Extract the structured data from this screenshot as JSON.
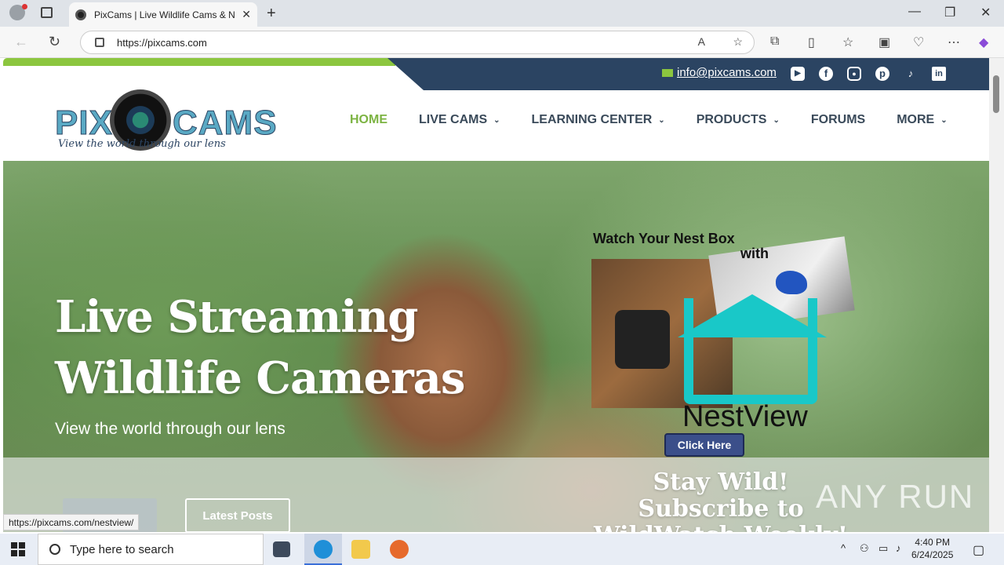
{
  "browser": {
    "tab_title": "PixCams | Live Wildlife Cams & Na",
    "url": "https://pixcams.com",
    "status_url": "https://pixcams.com/nestview/"
  },
  "site": {
    "email": "info@pixcams.com",
    "logo_left": "PIX",
    "logo_right": "CAMS",
    "logo_tagline": "View the world through our lens",
    "nav": [
      {
        "label": "HOME",
        "active": true
      },
      {
        "label": "LIVE CAMS",
        "caret": true
      },
      {
        "label": "LEARNING CENTER",
        "caret": true
      },
      {
        "label": "PRODUCTS",
        "caret": true
      },
      {
        "label": "FORUMS"
      },
      {
        "label": "MORE",
        "caret": true
      }
    ],
    "socials": [
      "youtube-icon",
      "facebook-icon",
      "instagram-icon",
      "pinterest-icon",
      "tiktok-icon",
      "linkedin-icon"
    ]
  },
  "hero": {
    "title_line1": "Live Streaming",
    "title_line2": "Wildlife Cameras",
    "subtitle": "View the world through our lens",
    "promo_head1": "Watch Your Nest Box",
    "promo_head2": "with",
    "promo_brand": "NestView",
    "promo_button": "Click Here"
  },
  "lower": {
    "btn_latest_posts": "Latest Posts",
    "subscribe_line1": "Stay Wild! Subscribe to",
    "subscribe_line2": "WildWatch Weekly!"
  },
  "watermark": "ANY RUN",
  "taskbar": {
    "search_placeholder": "Type here to search",
    "time": "4:40 PM",
    "date": "6/24/2025"
  },
  "colors": {
    "accent_green": "#8cc63f",
    "topbar_navy": "#2b4462",
    "nestview_teal": "#19c8c8"
  }
}
